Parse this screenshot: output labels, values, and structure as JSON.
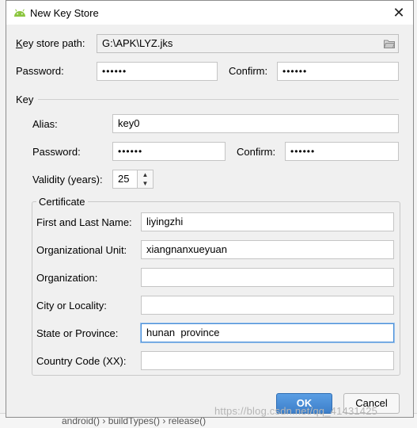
{
  "window": {
    "title": "New Key Store"
  },
  "keystore": {
    "path_label": "Key store path:",
    "path_value": "G:\\APK\\LYZ.jks",
    "password_label": "Password:",
    "password_value": "••••••",
    "confirm_label": "Confirm:",
    "confirm_value": "••••••"
  },
  "key": {
    "section_label": "Key",
    "alias_label": "Alias:",
    "alias_value": "key0",
    "password_label": "Password:",
    "password_value": "••••••",
    "confirm_label": "Confirm:",
    "confirm_value": "••••••",
    "validity_label": "Validity (years):",
    "validity_value": "25"
  },
  "certificate": {
    "group_label": "Certificate",
    "first_last_label": "First and Last Name:",
    "first_last_value": "liyingzhi",
    "org_unit_label": "Organizational Unit:",
    "org_unit_value": "xiangnanxueyuan",
    "org_label": "Organization:",
    "org_value": "",
    "city_label": "City or Locality:",
    "city_value": "",
    "state_label": "State or Province:",
    "state_value": "hunan  province",
    "country_label": "Country Code (XX):",
    "country_value": ""
  },
  "buttons": {
    "ok": "OK",
    "cancel": "Cancel"
  },
  "background": {
    "breadcrumb": "android()  ›  buildTypes()  ›  release()",
    "watermark": "https://blog.csdn.net/qq_41431425"
  }
}
